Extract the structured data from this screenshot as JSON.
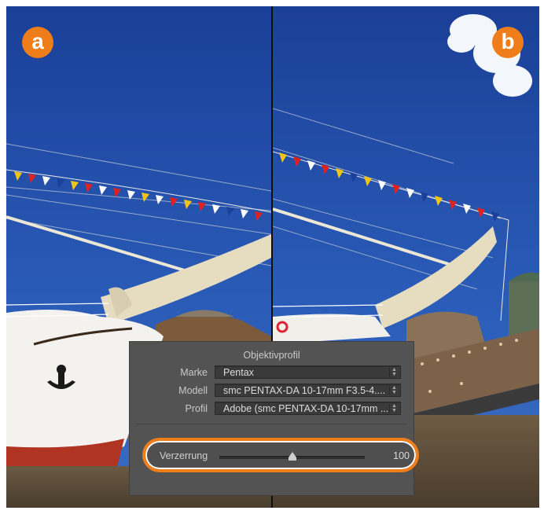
{
  "badges": {
    "left": "a",
    "right": "b"
  },
  "panel": {
    "title": "Objektivprofil",
    "rows": [
      {
        "label": "Marke",
        "value": "Pentax"
      },
      {
        "label": "Modell",
        "value": "smc PENTAX-DA 10-17mm F3.5-4...."
      },
      {
        "label": "Profil",
        "value": "Adobe (smc PENTAX-DA 10-17mm ..."
      }
    ],
    "slider": {
      "label": "Verzerrung",
      "value": "100",
      "level": 0.5
    }
  },
  "colors": {
    "accent": "#ef7d1a",
    "panel": "#535353",
    "sky": "#1f4aa3"
  },
  "icons": {
    "select_arrow": "up-down-arrows-icon",
    "slider_thumb": "slider-thumb-icon"
  }
}
